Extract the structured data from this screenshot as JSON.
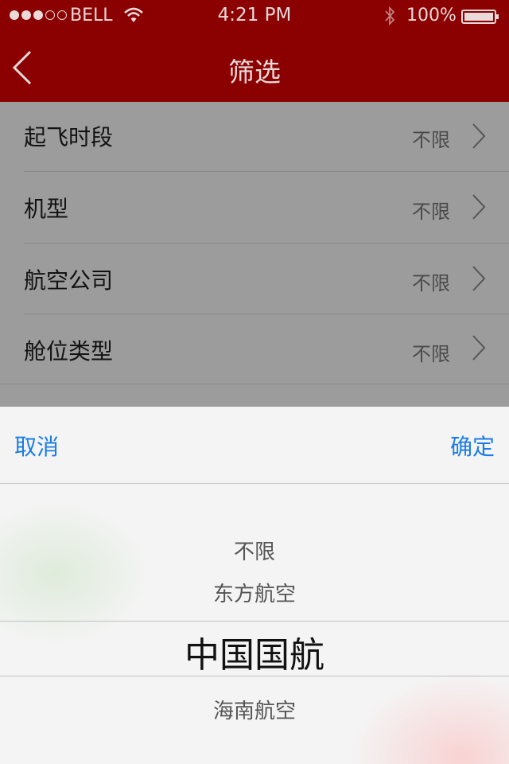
{
  "status_bar": {
    "carrier": "BELL",
    "time": "4:21 PM",
    "battery_percent": "100%",
    "signal_bars_filled": 3,
    "signal_bars_total": 5
  },
  "navbar": {
    "title": "筛选",
    "back_icon": "chevron-left-icon",
    "background_color": "#8b0000"
  },
  "filters": [
    {
      "label": "起飞时段",
      "value": "不限"
    },
    {
      "label": "机型",
      "value": "不限"
    },
    {
      "label": "航空公司",
      "value": "不限"
    },
    {
      "label": "舱位类型",
      "value": "不限"
    }
  ],
  "picker": {
    "cancel_label": "取消",
    "confirm_label": "确定",
    "accent_color": "#1a7ce8",
    "options": [
      "不限",
      "东方航空",
      "中国国航",
      "海南航空"
    ],
    "selected": "中国国航"
  }
}
